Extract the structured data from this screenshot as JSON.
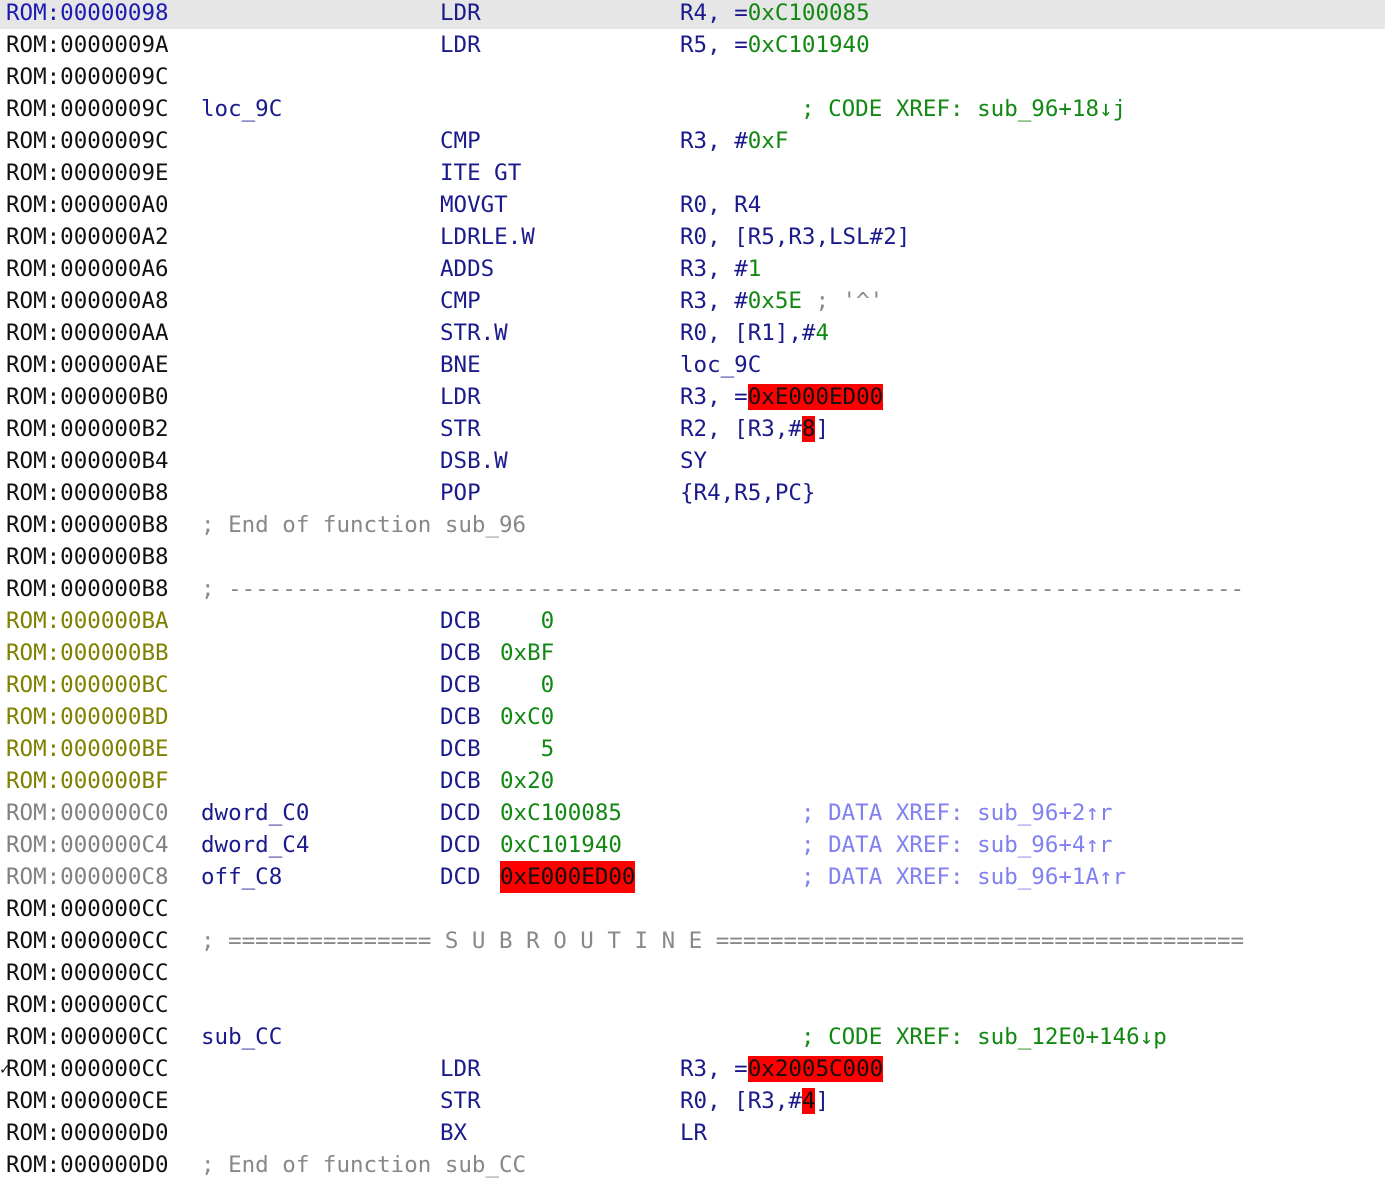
{
  "colors": {
    "background": "#ffffff",
    "current_line": "#e6e6e6",
    "address_current": "#1a1ab0",
    "address_data": "#7f7f00",
    "address_grey": "#808080",
    "mnemonic": "#1a1a8c",
    "number": "#118811",
    "xref_data": "#8080f0",
    "comment": "#888888",
    "highlight": "#ff0000"
  },
  "lines": [
    {
      "addr": "ROM:00000098",
      "mnemonic": "LDR",
      "op_reg": "R4, ",
      "op_pre": "=",
      "op_num": "0xC100085"
    },
    {
      "addr": "ROM:0000009A",
      "mnemonic": "LDR",
      "op_reg": "R5, ",
      "op_pre": "=",
      "op_num": "0xC101940"
    },
    {
      "addr": "ROM:0000009C"
    },
    {
      "addr": "ROM:0000009C",
      "label": "loc_9C",
      "comment": "; CODE XREF: sub_96+18↓j"
    },
    {
      "addr": "ROM:0000009C",
      "mnemonic": "CMP",
      "op_reg": "R3, ",
      "op_pre": "#",
      "op_num": "0xF"
    },
    {
      "addr": "ROM:0000009E",
      "mnemonic": "ITE GT"
    },
    {
      "addr": "ROM:000000A0",
      "mnemonic": "MOVGT",
      "op_reg": "R0, R4"
    },
    {
      "addr": "ROM:000000A2",
      "mnemonic": "LDRLE.W",
      "op_reg": "R0, [R5,R3,LSL#2]"
    },
    {
      "addr": "ROM:000000A6",
      "mnemonic": "ADDS",
      "op_reg": "R3, ",
      "op_pre": "#",
      "op_num": "1"
    },
    {
      "addr": "ROM:000000A8",
      "mnemonic": "CMP",
      "op_reg": "R3, ",
      "op_pre": "#",
      "op_num": "0x5E",
      "op_cmt": " ; '^'"
    },
    {
      "addr": "ROM:000000AA",
      "mnemonic": "STR.W",
      "op_reg": "R0, [R1],",
      "op_pre": "#",
      "op_num": "4"
    },
    {
      "addr": "ROM:000000AE",
      "mnemonic": "BNE",
      "op_reg": "loc_9C"
    },
    {
      "addr": "ROM:000000B0",
      "mnemonic": "LDR",
      "op_reg": "R3, =",
      "op_hl": "0xE000ED00"
    },
    {
      "addr": "ROM:000000B2",
      "mnemonic": "STR",
      "op_reg": "R2, [R3,#",
      "op_hl": "8",
      "op_post": "]"
    },
    {
      "addr": "ROM:000000B4",
      "mnemonic": "DSB.W",
      "op_reg": "SY"
    },
    {
      "addr": "ROM:000000B8",
      "mnemonic": "POP",
      "op_reg": "{R4,R5,PC}"
    },
    {
      "addr": "ROM:000000B8",
      "sep": "; End of function sub_96"
    },
    {
      "addr": "ROM:000000B8"
    },
    {
      "addr": "ROM:000000B8",
      "sep": "; ---------------------------------------------------------------------------"
    },
    {
      "addr": "ROM:000000BA",
      "mnemonic": "DCB",
      "dval": "   0"
    },
    {
      "addr": "ROM:000000BB",
      "mnemonic": "DCB",
      "dval": "0xBF"
    },
    {
      "addr": "ROM:000000BC",
      "mnemonic": "DCB",
      "dval": "   0"
    },
    {
      "addr": "ROM:000000BD",
      "mnemonic": "DCB",
      "dval": "0xC0"
    },
    {
      "addr": "ROM:000000BE",
      "mnemonic": "DCB",
      "dval": "   5"
    },
    {
      "addr": "ROM:000000BF",
      "mnemonic": "DCB",
      "dval": "0x20"
    },
    {
      "addr": "ROM:000000C0",
      "label": "dword_C0",
      "mnemonic": "DCD",
      "dval": "0xC100085",
      "comment": "; DATA XREF: sub_96+2↑r"
    },
    {
      "addr": "ROM:000000C4",
      "label": "dword_C4",
      "mnemonic": "DCD",
      "dval": "0xC101940",
      "comment": "; DATA XREF: sub_96+4↑r"
    },
    {
      "addr": "ROM:000000C8",
      "label": "off_C8",
      "mnemonic": "DCD",
      "dval_hl": "0xE000ED00",
      "comment": "; DATA XREF: sub_96+1A↑r"
    },
    {
      "addr": "ROM:000000CC"
    },
    {
      "addr": "ROM:000000CC",
      "sep": "; =============== S U B R O U T I N E ======================================="
    },
    {
      "addr": "ROM:000000CC"
    },
    {
      "addr": "ROM:000000CC"
    },
    {
      "addr": "ROM:000000CC",
      "label": "sub_CC",
      "comment": "; CODE XREF: sub_12E0+146↓p"
    },
    {
      "addr": "ROM:000000CC",
      "mnemonic": "LDR",
      "op_reg": "R3, =",
      "op_hl": "0x2005C000",
      "marker": "✓"
    },
    {
      "addr": "ROM:000000CE",
      "mnemonic": "STR",
      "op_reg": "R0, [R3,#",
      "op_hl": "4",
      "op_post": "]"
    },
    {
      "addr": "ROM:000000D0",
      "mnemonic": "BX",
      "op_reg": "LR"
    },
    {
      "addr": "ROM:000000D0",
      "sep": "; End of function sub_CC"
    }
  ]
}
